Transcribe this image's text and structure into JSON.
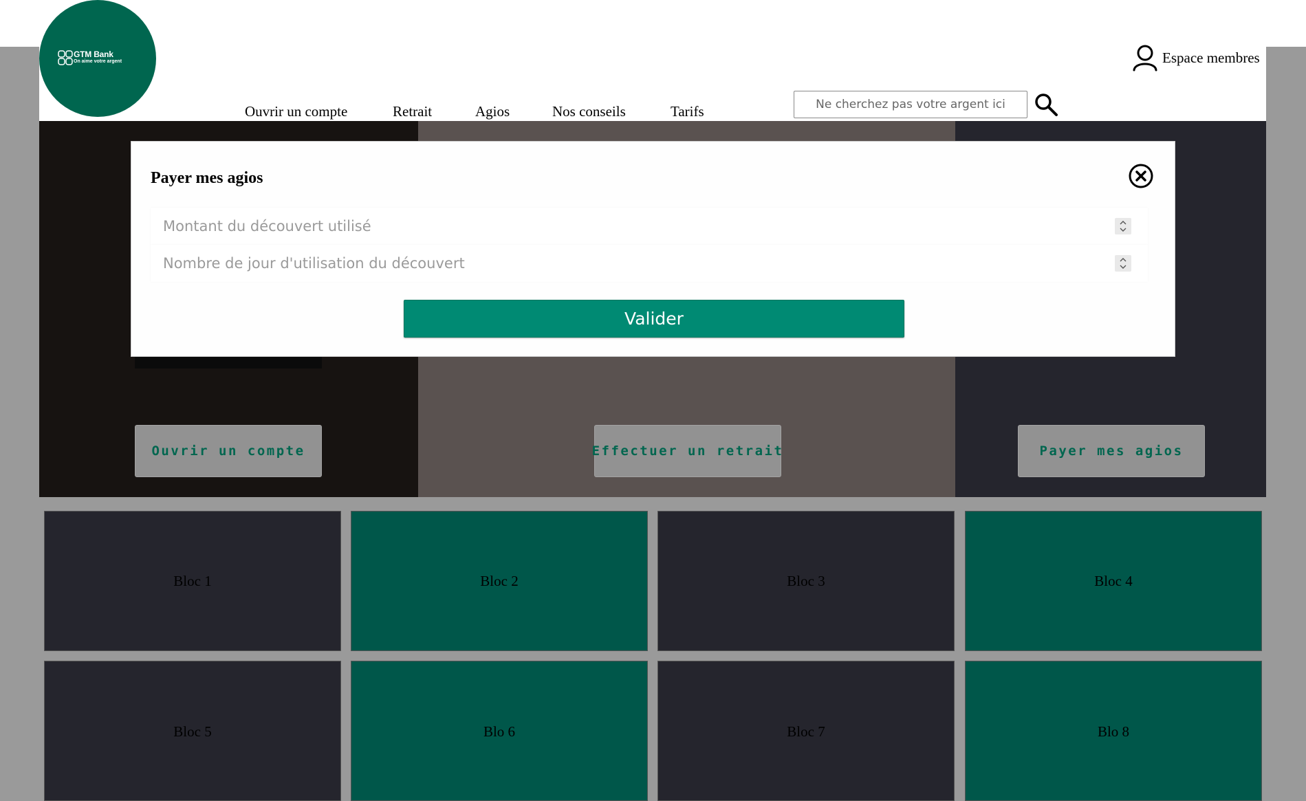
{
  "brand": {
    "name": "GTM Bank",
    "tagline": "On aime votre argent"
  },
  "nav": [
    "Ouvrir un compte",
    "Retrait",
    "Agios",
    "Nos conseils",
    "Tarifs"
  ],
  "search": {
    "placeholder": "Ne cherchez pas votre argent ici"
  },
  "members_label": "Espace membres",
  "hero_buttons": [
    "Ouvrir un compte",
    "Effectuer un retrait",
    "Payer mes agios"
  ],
  "blocs": [
    "Bloc 1",
    "Bloc 2",
    "Bloc 3",
    "Bloc 4",
    "Bloc 5",
    "Blo 6",
    "Bloc 7",
    "Blo 8"
  ],
  "modal": {
    "title": "Payer mes agios",
    "field1_placeholder": "Montant du découvert utilisé",
    "field2_placeholder": "Nombre de jour d'utilisation du découvert",
    "submit_label": "Valider"
  },
  "colors": {
    "brand_green": "#00664f",
    "button_green": "#008a73",
    "bloc_dark": "#25252d",
    "bloc_green": "#00574a"
  },
  "icons": [
    "user-icon",
    "search-icon",
    "close-icon",
    "logo-icon"
  ]
}
